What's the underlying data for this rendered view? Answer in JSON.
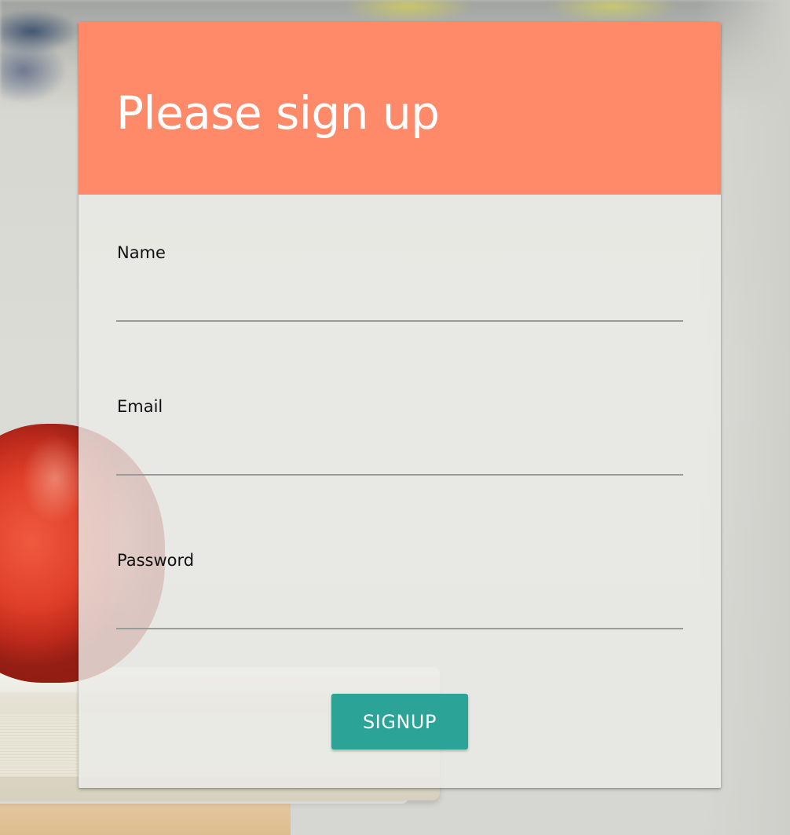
{
  "form": {
    "title": "Please sign up",
    "fields": [
      {
        "label": "Name",
        "value": "",
        "type": "text"
      },
      {
        "label": "Email",
        "value": "",
        "type": "email"
      },
      {
        "label": "Password",
        "value": "",
        "type": "password"
      }
    ],
    "submit_label": "SIGNUP"
  },
  "colors": {
    "header": "#ff8a69",
    "button": "#2ba396",
    "card_background": "#eaeae6"
  },
  "background": {
    "image_subject": "apple-on-books"
  }
}
